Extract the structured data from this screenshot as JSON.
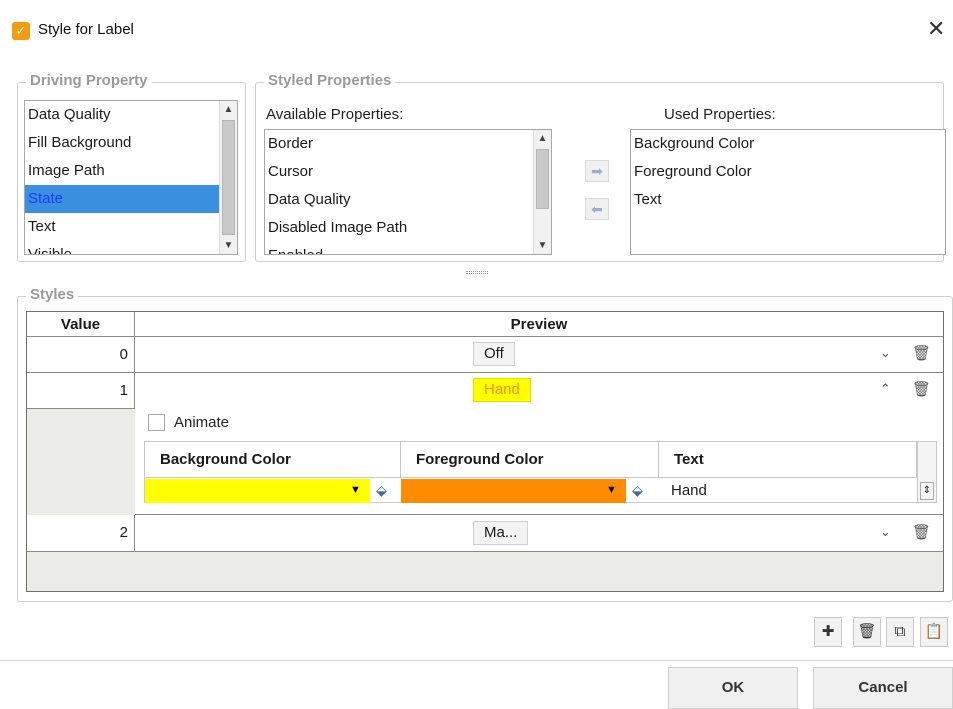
{
  "window": {
    "title": "Style for Label",
    "app_icon": "checkmark-brush-icon",
    "close_glyph": "✕"
  },
  "driving_property": {
    "legend": "Driving Property",
    "items": [
      "Data Quality",
      "Fill Background",
      "Image Path",
      "State",
      "Text",
      "Visible"
    ],
    "selected": "State"
  },
  "styled_properties": {
    "legend": "Styled Properties",
    "available_label": "Available Properties:",
    "available": [
      "Border",
      "Cursor",
      "Data Quality",
      "Disabled Image Path",
      "Enabled"
    ],
    "used_label": "Used Properties:",
    "used": [
      "Background Color",
      "Foreground Color",
      "Text"
    ]
  },
  "styles": {
    "legend": "Styles",
    "col_value": "Value",
    "col_preview": "Preview",
    "rows": [
      {
        "value": "0",
        "preview": "Off",
        "expanded": false
      },
      {
        "value": "1",
        "preview": "Hand",
        "expanded": true
      },
      {
        "value": "2",
        "preview": "Ma...",
        "expanded": false
      }
    ],
    "animate_label": "Animate",
    "detail_headers": [
      "Background Color",
      "Foreground Color",
      "Text"
    ],
    "detail_text_value": "Hand",
    "colors": {
      "background": "#ffff00",
      "foreground": "#ff8c00",
      "preview_hand_bg": "#ffff00",
      "preview_hand_fg": "#ff8c00"
    }
  },
  "buttons": {
    "ok": "OK",
    "cancel": "Cancel"
  }
}
